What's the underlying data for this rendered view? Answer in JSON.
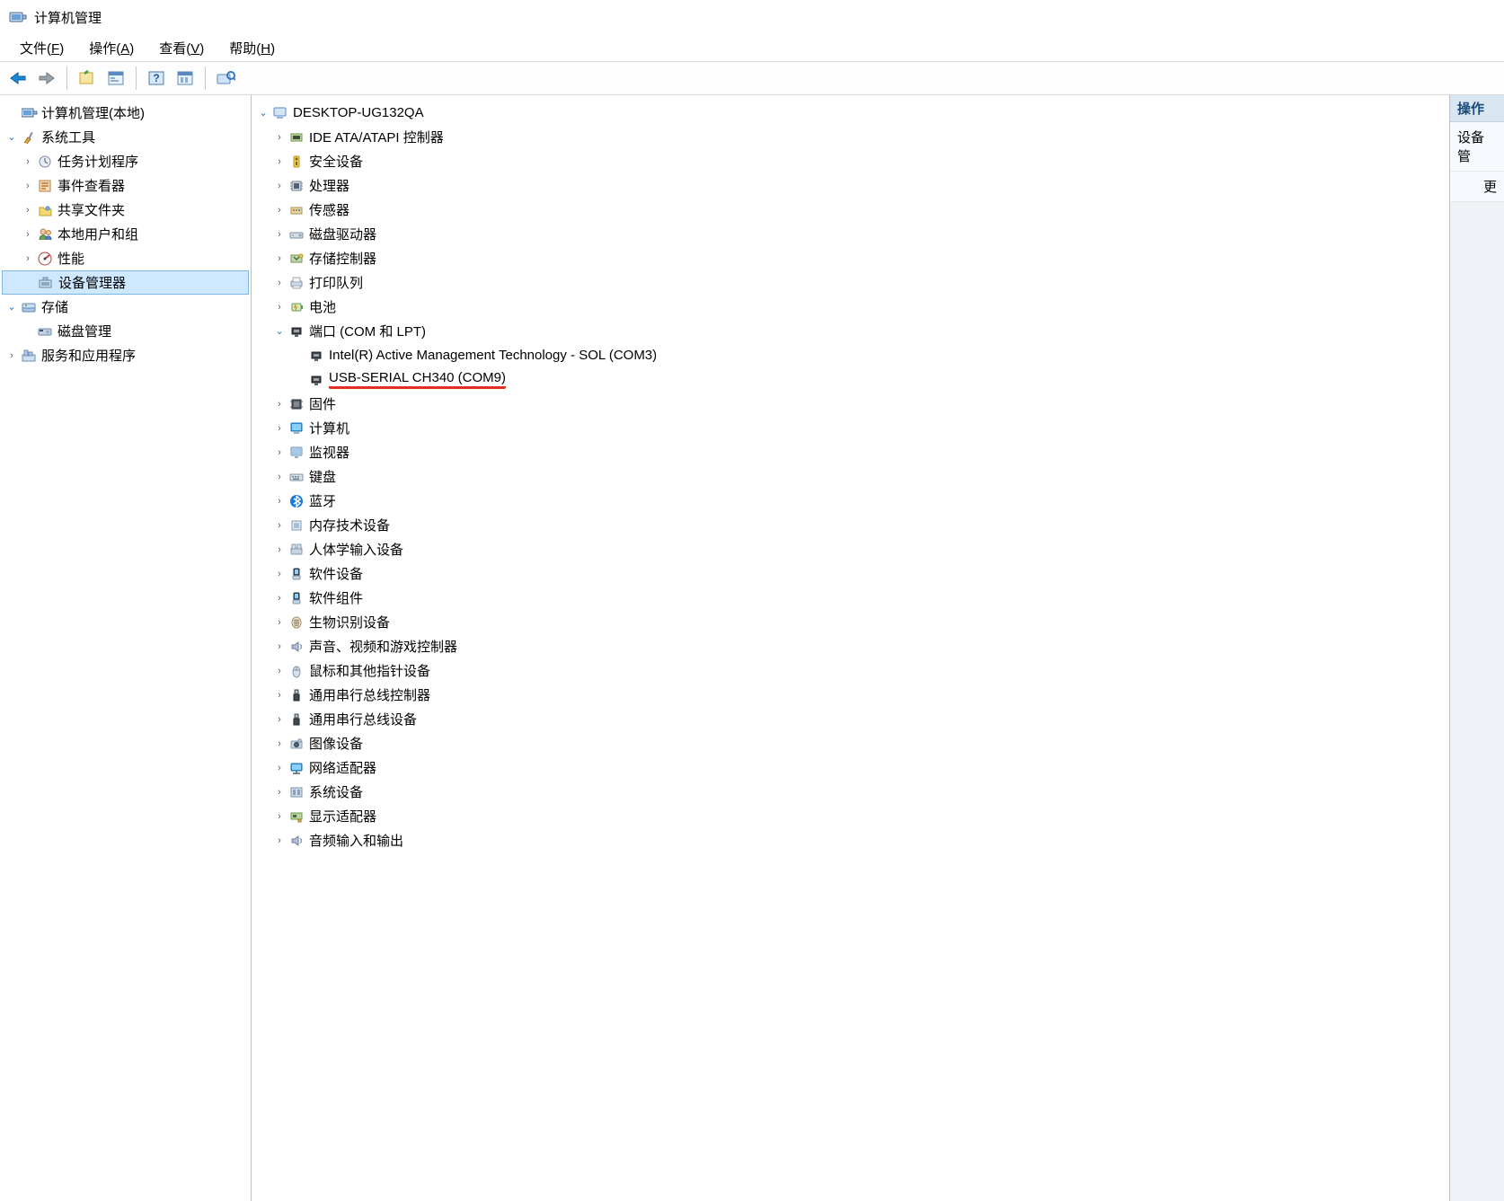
{
  "title": "计算机管理",
  "menu": {
    "file": "文件",
    "action": "操作",
    "view": "查看",
    "help": "帮助",
    "file_u": "F",
    "action_u": "A",
    "view_u": "V",
    "help_u": "H"
  },
  "left_tree": {
    "root": "计算机管理(本地)",
    "system_tools": "系统工具",
    "system_tools_children": [
      "任务计划程序",
      "事件查看器",
      "共享文件夹",
      "本地用户和组",
      "性能",
      "设备管理器"
    ],
    "storage": "存储",
    "storage_children": [
      "磁盘管理"
    ],
    "services": "服务和应用程序"
  },
  "devices": {
    "computer": "DESKTOP-UG132QA",
    "cats": [
      "IDE ATA/ATAPI 控制器",
      "安全设备",
      "处理器",
      "传感器",
      "磁盘驱动器",
      "存储控制器",
      "打印队列",
      "电池"
    ],
    "ports_label": "端口 (COM 和 LPT)",
    "ports_children": [
      "Intel(R) Active Management Technology - SOL (COM3)",
      "USB-SERIAL CH340 (COM9)"
    ],
    "cats2": [
      "固件",
      "计算机",
      "监视器",
      "键盘",
      "蓝牙",
      "内存技术设备",
      "人体学输入设备",
      "软件设备",
      "软件组件",
      "生物识别设备",
      "声音、视频和游戏控制器",
      "鼠标和其他指针设备",
      "通用串行总线控制器",
      "通用串行总线设备",
      "图像设备",
      "网络适配器",
      "系统设备",
      "显示适配器",
      "音频输入和输出"
    ]
  },
  "right": {
    "header": "操作",
    "item1": "设备管",
    "item2": "更"
  }
}
